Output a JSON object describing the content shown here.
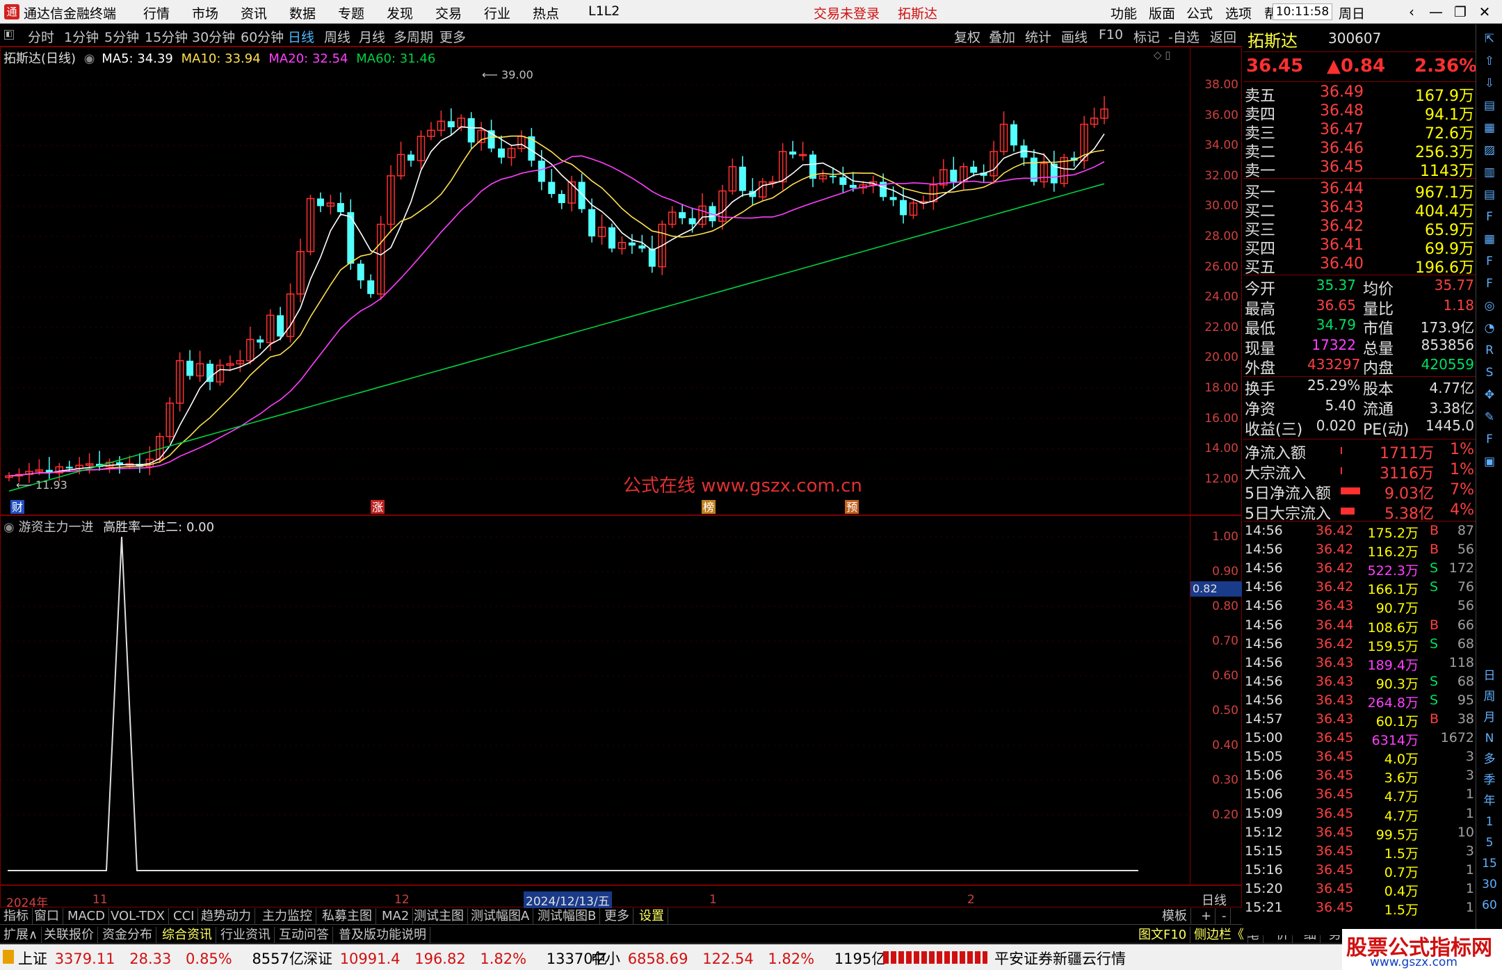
{
  "app": {
    "title": "通达信金融终端",
    "trade_status": "交易未登录",
    "stock_link": "拓斯达",
    "time": "10:11:58",
    "weekday": "周日"
  },
  "menu": [
    "行情",
    "市场",
    "资讯",
    "数据",
    "专题",
    "发现",
    "交易",
    "行业",
    "热点",
    "L1L2"
  ],
  "menu_right": [
    "功能",
    "版面",
    "公式",
    "选项",
    "帮助"
  ],
  "periods": [
    "分时",
    "1分钟",
    "5分钟",
    "15分钟",
    "30分钟",
    "60分钟",
    "日线",
    "周线",
    "月线",
    "多周期",
    "更多"
  ],
  "active_period": "日线",
  "toolbar_right": [
    "复权",
    "叠加",
    "统计",
    "画线",
    "F10",
    "标记",
    "-自选",
    "返回"
  ],
  "chart_header": {
    "name": "拓斯达(日线)",
    "ma5": "MA5: 34.39",
    "ma10": "MA10: 33.94",
    "ma20": "MA20: 32.54",
    "ma60": "MA60: 31.46"
  },
  "chart_annotations": {
    "high": "39.00",
    "low": "11.93",
    "watermark": "公式在线  www.gszx.com.cn",
    "markers": [
      "财",
      "涨",
      "榜",
      "预"
    ]
  },
  "price_axis": [
    "38.00",
    "36.00",
    "34.00",
    "32.00",
    "30.00",
    "28.00",
    "26.00",
    "24.00",
    "22.00",
    "20.00",
    "18.00",
    "16.00",
    "14.00",
    "12.00"
  ],
  "osc_header": {
    "name": "游资主力一进",
    "indicator": "高胜率一进二: 0.00"
  },
  "osc_axis": [
    "1.00",
    "0.90",
    "0.80",
    "0.70",
    "0.60",
    "0.50",
    "0.40",
    "0.30",
    "0.20"
  ],
  "osc_cursor": "0.82",
  "date_axis": {
    "labels": [
      "2024年",
      "11",
      "12",
      "2024/12/13/五",
      "1",
      "2"
    ],
    "right": "日线"
  },
  "bottom_tabs": [
    "指标",
    "窗口",
    "MACD",
    "VOL-TDX",
    "CCI",
    "趋势动力",
    "主力监控",
    "私募主图",
    "MA2",
    "测试主图",
    "测试幅图A",
    "测试幅图B",
    "更多",
    "设置"
  ],
  "bottom_tabs_right": [
    "模板",
    "+",
    "-"
  ],
  "info_tabs": [
    "扩展∧",
    "关联报价",
    "资金分布",
    "综合资讯",
    "行业资讯",
    "互动问答",
    "普及版功能说明"
  ],
  "info_tabs_right": [
    "图文F10",
    "侧边栏《",
    "笔",
    "价",
    "细",
    "势"
  ],
  "quote": {
    "name": "拓斯达",
    "code": "300607",
    "price": "36.45",
    "change": "▲0.84",
    "pct": "2.36%",
    "asks": [
      {
        "label": "卖五",
        "price": "36.49",
        "vol": "167.9万"
      },
      {
        "label": "卖四",
        "price": "36.48",
        "vol": "94.1万"
      },
      {
        "label": "卖三",
        "price": "36.47",
        "vol": "72.6万"
      },
      {
        "label": "卖二",
        "price": "36.46",
        "vol": "256.3万"
      },
      {
        "label": "卖一",
        "price": "36.45",
        "vol": "1143万"
      }
    ],
    "bids": [
      {
        "label": "买一",
        "price": "36.44",
        "vol": "967.1万"
      },
      {
        "label": "买二",
        "price": "36.43",
        "vol": "404.4万"
      },
      {
        "label": "买三",
        "price": "36.42",
        "vol": "65.9万"
      },
      {
        "label": "买四",
        "price": "36.41",
        "vol": "69.9万"
      },
      {
        "label": "买五",
        "price": "36.40",
        "vol": "196.6万"
      }
    ],
    "stats": [
      {
        "l1": "今开",
        "v1": "35.37",
        "c1": "green",
        "l2": "均价",
        "v2": "35.77",
        "c2": "red"
      },
      {
        "l1": "最高",
        "v1": "36.65",
        "c1": "red",
        "l2": "量比",
        "v2": "1.18",
        "c2": "red"
      },
      {
        "l1": "最低",
        "v1": "34.79",
        "c1": "green",
        "l2": "市值",
        "v2": "173.9亿",
        "c2": "white"
      },
      {
        "l1": "现量",
        "v1": "17322",
        "c1": "magenta",
        "l2": "总量",
        "v2": "853856",
        "c2": "white"
      },
      {
        "l1": "外盘",
        "v1": "433297",
        "c1": "red",
        "l2": "内盘",
        "v2": "420559",
        "c2": "green"
      }
    ],
    "stats2": [
      {
        "l1": "换手",
        "v1": "25.29%",
        "l2": "股本",
        "v2": "4.77亿"
      },
      {
        "l1": "净资",
        "v1": "5.40",
        "l2": "流通",
        "v2": "3.38亿"
      },
      {
        "l1": "收益(三)",
        "v1": "0.020",
        "l2": "PE(动)",
        "v2": "1445.0"
      }
    ],
    "flows": [
      {
        "label": "净流入额",
        "value": "1711万",
        "pct": "1%",
        "bar": 0.05
      },
      {
        "label": "大宗流入",
        "value": "3116万",
        "pct": "1%",
        "bar": 0.05
      },
      {
        "label": "5日净流入额",
        "value": "9.03亿",
        "pct": "7%",
        "bar": 0.7
      },
      {
        "label": "5日大宗流入",
        "value": "5.38亿",
        "pct": "4%",
        "bar": 0.5
      }
    ]
  },
  "ticks": [
    {
      "t": "14:56",
      "p": "36.42",
      "v": "175.2万",
      "vc": "yellow",
      "d": "B",
      "n": "87"
    },
    {
      "t": "14:56",
      "p": "36.42",
      "v": "116.2万",
      "vc": "yellow",
      "d": "B",
      "n": "56"
    },
    {
      "t": "14:56",
      "p": "36.42",
      "v": "522.3万",
      "vc": "magenta",
      "d": "S",
      "n": "172"
    },
    {
      "t": "14:56",
      "p": "36.42",
      "v": "166.1万",
      "vc": "yellow",
      "d": "S",
      "n": "76"
    },
    {
      "t": "14:56",
      "p": "36.43",
      "v": "90.7万",
      "vc": "yellow",
      "d": "",
      "n": "56"
    },
    {
      "t": "14:56",
      "p": "36.44",
      "v": "108.6万",
      "vc": "yellow",
      "d": "B",
      "n": "66"
    },
    {
      "t": "14:56",
      "p": "36.42",
      "v": "159.5万",
      "vc": "yellow",
      "d": "S",
      "n": "68"
    },
    {
      "t": "14:56",
      "p": "36.43",
      "v": "189.4万",
      "vc": "magenta",
      "d": "",
      "n": "118"
    },
    {
      "t": "14:56",
      "p": "36.43",
      "v": "90.3万",
      "vc": "yellow",
      "d": "S",
      "n": "68"
    },
    {
      "t": "14:56",
      "p": "36.43",
      "v": "264.8万",
      "vc": "magenta",
      "d": "S",
      "n": "95"
    },
    {
      "t": "14:57",
      "p": "36.43",
      "v": "60.1万",
      "vc": "yellow",
      "d": "B",
      "n": "38"
    },
    {
      "t": "15:00",
      "p": "36.45",
      "v": "6314万",
      "vc": "magenta",
      "d": "",
      "n": "1672"
    },
    {
      "t": "15:05",
      "p": "36.45",
      "v": "4.0万",
      "vc": "yellow",
      "d": "",
      "n": "3"
    },
    {
      "t": "15:06",
      "p": "36.45",
      "v": "3.6万",
      "vc": "yellow",
      "d": "",
      "n": "3"
    },
    {
      "t": "15:06",
      "p": "36.45",
      "v": "4.7万",
      "vc": "yellow",
      "d": "",
      "n": "1"
    },
    {
      "t": "15:09",
      "p": "36.45",
      "v": "4.7万",
      "vc": "yellow",
      "d": "",
      "n": "1"
    },
    {
      "t": "15:12",
      "p": "36.45",
      "v": "99.5万",
      "vc": "yellow",
      "d": "",
      "n": "10"
    },
    {
      "t": "15:15",
      "p": "36.45",
      "v": "1.5万",
      "vc": "yellow",
      "d": "",
      "n": "3"
    },
    {
      "t": "15:16",
      "p": "36.45",
      "v": "0.7万",
      "vc": "yellow",
      "d": "",
      "n": "1"
    },
    {
      "t": "15:20",
      "p": "36.45",
      "v": "0.4万",
      "vc": "yellow",
      "d": "",
      "n": "1"
    },
    {
      "t": "15:21",
      "p": "36.45",
      "v": "1.5万",
      "vc": "yellow",
      "d": "",
      "n": "1"
    }
  ],
  "side_buttons": [
    "日",
    "周",
    "月",
    "N",
    "多",
    "季",
    "年",
    "1",
    "5",
    "15",
    "30",
    "60"
  ],
  "status_bar": {
    "sh": {
      "name": "上证",
      "value": "3379.11",
      "chg": "28.33",
      "pct": "0.85%",
      "amt": "8557亿"
    },
    "sz": {
      "name": "深证",
      "value": "10991.4",
      "chg": "196.82",
      "pct": "1.82%",
      "amt": "13370亿"
    },
    "zx": {
      "name": "中小",
      "value": "6858.69",
      "chg": "122.54",
      "pct": "1.82%",
      "amt": "1195亿"
    },
    "server": "平安证券新疆云行情",
    "brand": "股票公式指标网",
    "brand_url": "www.gszx.com"
  },
  "colors": {
    "up": "#ff3030",
    "down": "#54ffff",
    "ma5": "#ffffff",
    "ma10": "#ffe050",
    "ma20": "#ff40ff",
    "ma60": "#00d040"
  }
}
